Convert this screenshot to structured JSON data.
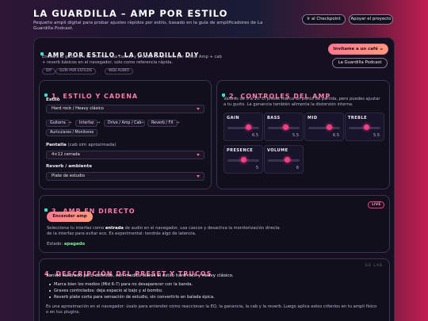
{
  "header": {
    "title": "LA GUARDILLA – AMP POR ESTILO",
    "subtitle": "Pequeño ampli digital para probar ajustes rápidos por estilo, basado en la guía de amplificadores de La Guardilla Podcast.",
    "btn_checkpoint": "Ir al Checkpoint",
    "btn_support": "Apoyar el proyecto"
  },
  "intro": {
    "title": "AMP POR ESTILO – LA GUARDILLA DIY",
    "desc": "Enchufa la guitarra a tu interfaz, usa cascos y prueba los presets por estilo. Amp + cab + reverb básicos en el navegador, solo como referencia rápida.",
    "tags": [
      "DIY",
      "GUÍA POR ESTILOS",
      "WEB AUDIO"
    ],
    "coffee_btn": "Invítame a un café ☕",
    "podcast_btn": "La Guardilla Podcast"
  },
  "section1": {
    "title": "1. ESTILO Y CADENA",
    "style_label": "Estilo",
    "style_value": "Hard rock / Heavy clásico",
    "chain": [
      "Guitarra",
      "Interfaz",
      "Drive / Amp / Cab",
      "Reverb / FX",
      "Auriculares / Monitores"
    ],
    "arrow": "→",
    "cab_label": "Pantalla",
    "cab_note": "(cab sim aproximada)",
    "cab_value": "4×12 cerrada",
    "reverb_label": "Reverb / ambiente",
    "reverb_value": "Plate de estudio"
  },
  "section2": {
    "title": "2. CONTROLES DEL AMP",
    "desc": "Valores de 0 a 10. El preset marca un punto de partida, pero puedes ajustar a tu gusto. La ganancia también alimenta la distorsión interna.",
    "knobs": [
      {
        "label": "GAIN",
        "value": "6.5",
        "level": 0.65
      },
      {
        "label": "BASS",
        "value": "5.5",
        "level": 0.55
      },
      {
        "label": "MID",
        "value": "6.5",
        "level": 0.65
      },
      {
        "label": "TREBLE",
        "value": "5.5",
        "level": 0.55
      },
      {
        "label": "PRESENCE",
        "value": "5",
        "level": 0.5
      },
      {
        "label": "VOLUME",
        "value": "6",
        "level": 0.6
      }
    ]
  },
  "section3": {
    "title": "3. AMP EN DIRECTO",
    "live": "LIVE",
    "btn": "Encender amp",
    "desc_pre": "Selecciona tu interfaz como ",
    "desc_bold": "entrada",
    "desc_post": " de audio en el navegador, usa cascos y desactiva la monitorización directa de la interfaz para evitar eco. Es experimental: tendrás algo de latencia.",
    "status_label": "Estado:",
    "status_value": "apagado"
  },
  "section4": {
    "title": "4. DESCRIPCIÓN DEL PRESET Y TRUCOS",
    "corner": "SG LAB",
    "lead": "Sonido saturado pero definido, con medios claros al estilo hard rock y heavy clásico.",
    "bullets": [
      "Marca bien los medios (Mid 6-7) para no desaparecer con la banda.",
      "Graves controlados: deja espacio al bajo y al bombo.",
      "Reverb plate corta para sensación de estudio, sin convertirlo en balada épica."
    ],
    "foot": "Es una aproximación en el navegador: úsalo para entender cómo reaccionan la EQ, la ganancia, la cab y la reverb. Luego aplica estos criterios en tu ampli físico o en tus plugins."
  }
}
